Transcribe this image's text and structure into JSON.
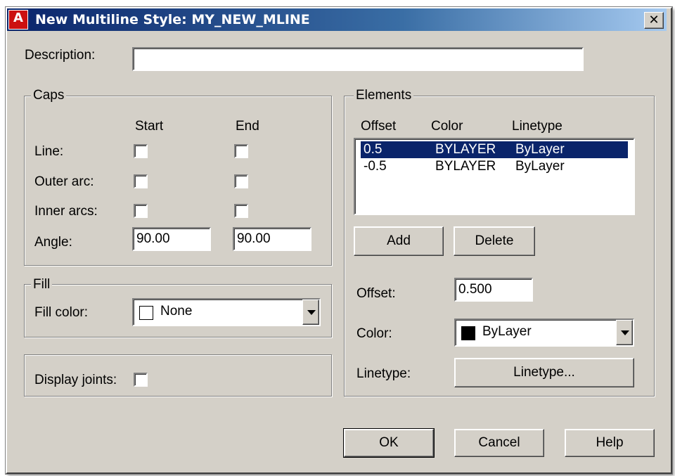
{
  "window": {
    "title": "New Multiline Style: MY_NEW_MLINE",
    "close_glyph": "✕",
    "app_icon_letter": "A"
  },
  "description": {
    "label": "Description:",
    "value": ""
  },
  "caps": {
    "title": "Caps",
    "start_header": "Start",
    "end_header": "End",
    "rows": [
      {
        "label": "Line:",
        "start_checked": false,
        "end_checked": false
      },
      {
        "label": "Outer arc:",
        "start_checked": false,
        "end_checked": false
      },
      {
        "label": "Inner arcs:",
        "start_checked": false,
        "end_checked": false
      }
    ],
    "angle_label": "Angle:",
    "angle_start": "90.00",
    "angle_end": "90.00"
  },
  "fill": {
    "title": "Fill",
    "color_label": "Fill color:",
    "color_value": "None",
    "swatch_color": "#ffffff"
  },
  "display_joints": {
    "label": "Display joints:",
    "checked": false
  },
  "elements": {
    "title": "Elements",
    "headers": {
      "offset": "Offset",
      "color": "Color",
      "linetype": "Linetype"
    },
    "rows": [
      {
        "offset": "0.5",
        "color": "BYLAYER",
        "linetype": "ByLayer",
        "selected": true
      },
      {
        "offset": "-0.5",
        "color": "BYLAYER",
        "linetype": "ByLayer",
        "selected": false
      }
    ],
    "add_label": "Add",
    "delete_label": "Delete",
    "offset_label": "Offset:",
    "offset_value": "0.500",
    "color_label": "Color:",
    "color_value": "ByLayer",
    "color_swatch": "#000000",
    "linetype_label": "Linetype:",
    "linetype_button": "Linetype..."
  },
  "footer": {
    "ok_label": "OK",
    "cancel_label": "Cancel",
    "help_label": "Help"
  },
  "colors": {
    "face": "#d4d0c8",
    "selection": "#0a246a",
    "title_start": "#0a246a",
    "title_end": "#a6caf0"
  }
}
